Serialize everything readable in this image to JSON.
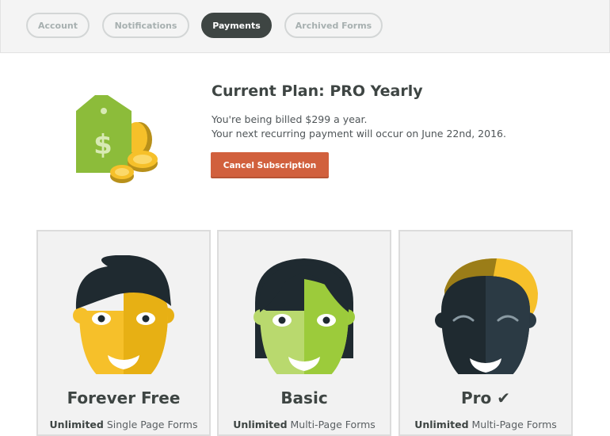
{
  "tabs": [
    {
      "label": "Account",
      "active": false
    },
    {
      "label": "Notifications",
      "active": false
    },
    {
      "label": "Payments",
      "active": true
    },
    {
      "label": "Archived Forms",
      "active": false
    }
  ],
  "current_plan": {
    "title": "Current Plan: PRO Yearly",
    "billing_line": "You're being billed $299 a year.",
    "next_payment_line": "Your next recurring payment will occur on June 22nd, 2016.",
    "cancel_label": "Cancel Subscription",
    "illustration": "price-tag-with-coins"
  },
  "plans": [
    {
      "name": "Forever Free",
      "desc_bold": "Unlimited",
      "desc_rest": " Single Page Forms",
      "selected": false,
      "face_color": "#f6c02a"
    },
    {
      "name": "Basic",
      "desc_bold": "Unlimited",
      "desc_rest": " Multi-Page Forms",
      "selected": false,
      "face_color": "#9ccb3b"
    },
    {
      "name": "Pro",
      "desc_bold": "Unlimited",
      "desc_rest": " Multi-Page Forms",
      "selected": true,
      "face_color": "#22303a",
      "selected_icon": "checkmark-icon"
    }
  ],
  "colors": {
    "accent": "#d1603d",
    "active_tab": "#3e4543",
    "tag_green": "#8cbc3a",
    "coin_gold": "#f6c02a"
  }
}
